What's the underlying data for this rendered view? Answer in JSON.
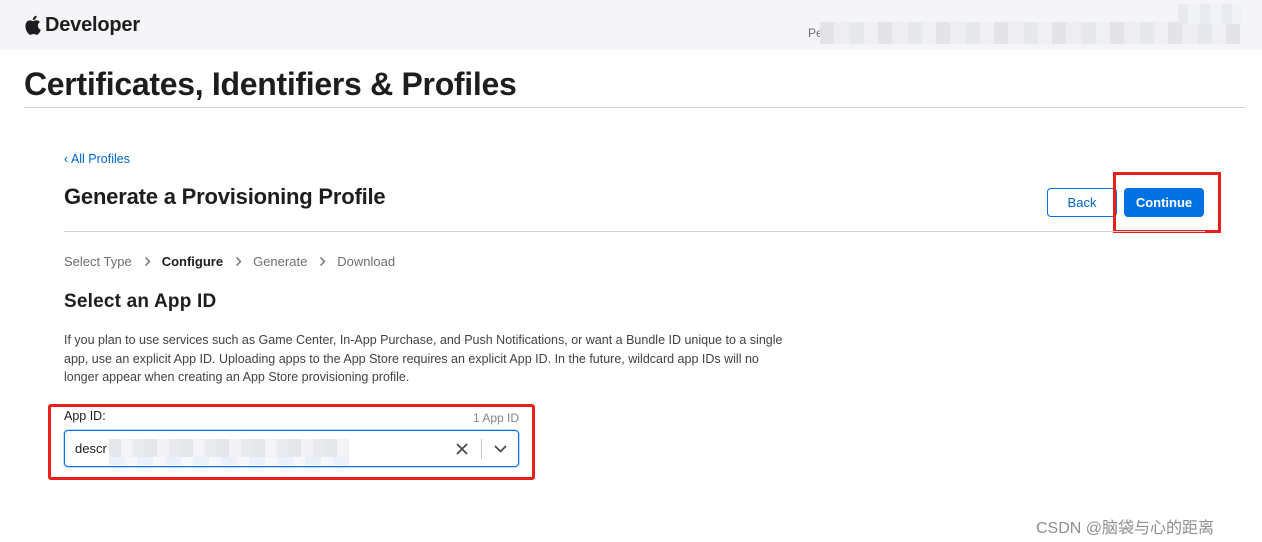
{
  "header": {
    "brand_label": "Developer",
    "account_text": "Pe"
  },
  "page": {
    "title": "Certificates, Identifiers & Profiles"
  },
  "content": {
    "back_link": "‹ All Profiles",
    "section_title": "Generate a Provisioning Profile",
    "buttons": {
      "back_label": "Back",
      "continue_label": "Continue"
    },
    "steps": [
      {
        "label": "Select Type",
        "active": false
      },
      {
        "label": "Configure",
        "active": true
      },
      {
        "label": "Generate",
        "active": false
      },
      {
        "label": "Download",
        "active": false
      }
    ],
    "subsection_title": "Select an App ID",
    "description": "If you plan to use services such as Game Center, In-App Purchase, and Push Notifications, or want a Bundle ID unique to a single app, use an explicit App ID. Uploading apps to the App Store requires an explicit App ID. In the future, wildcard app IDs will no longer appear when creating an App Store provisioning profile.",
    "app_id_field": {
      "label": "App ID:",
      "count": "1 App ID",
      "value": "descr"
    }
  },
  "watermark": "CSDN @脑袋与心的距离",
  "icons": {
    "brand": "apple-logo-icon",
    "clear": "close-icon",
    "dropdown": "chevron-down-icon",
    "step_separator": "chevron-right-icon"
  },
  "colors": {
    "accent": "#0071e3",
    "link": "#0066cc",
    "annotation": "#e8201b",
    "topbar": "#f5f5f7"
  }
}
